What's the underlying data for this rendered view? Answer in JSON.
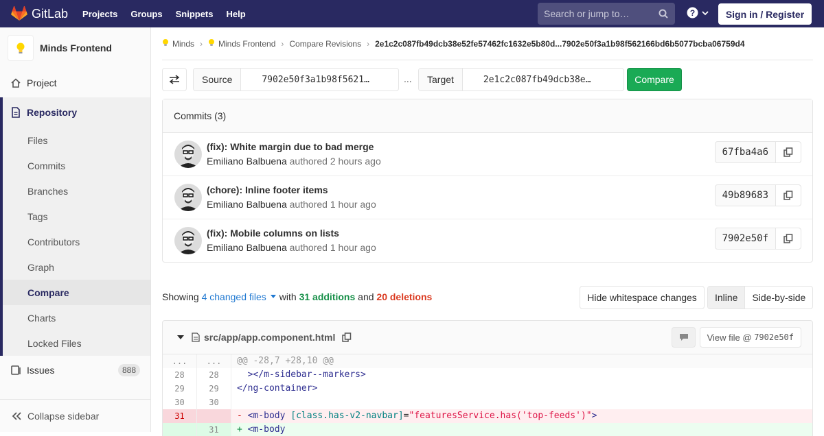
{
  "header": {
    "brand": "GitLab",
    "nav": [
      "Projects",
      "Groups",
      "Snippets",
      "Help"
    ],
    "search_placeholder": "Search or jump to…",
    "sign_in": "Sign in / Register"
  },
  "sidebar": {
    "project_name": "Minds Frontend",
    "project": "Project",
    "repository": "Repository",
    "repo_items": [
      "Files",
      "Commits",
      "Branches",
      "Tags",
      "Contributors",
      "Graph",
      "Compare",
      "Charts",
      "Locked Files"
    ],
    "issues": "Issues",
    "issues_count": "888",
    "collapse": "Collapse sidebar"
  },
  "breadcrumb": {
    "items": [
      "Minds",
      "Minds Frontend",
      "Compare Revisions"
    ],
    "current": "2e1c2c087fb49dcb38e52fe57462fc1632e5b80d...7902e50f3a1b98f562166bd6b5077bcba06759d4"
  },
  "compare": {
    "source_label": "Source",
    "source_value": "7902e50f3a1b98f5621…",
    "dots": "...",
    "target_label": "Target",
    "target_value": "2e1c2c087fb49dcb38e…",
    "compare_button": "Compare"
  },
  "commits": {
    "heading": "Commits (3)",
    "items": [
      {
        "title": "(fix): White margin due to bad merge",
        "author": "Emiliano Balbuena",
        "action": "authored",
        "time": "2 hours ago",
        "sha": "67fba4a6"
      },
      {
        "title": "(chore): Inline footer items",
        "author": "Emiliano Balbuena",
        "action": "authored",
        "time": "1 hour ago",
        "sha": "49b89683"
      },
      {
        "title": "(fix): Mobile columns on lists",
        "author": "Emiliano Balbuena",
        "action": "authored",
        "time": "1 hour ago",
        "sha": "7902e50f"
      }
    ]
  },
  "stats": {
    "showing": "Showing",
    "changed_files": "4 changed files",
    "with": "with",
    "additions": "31 additions",
    "and": "and",
    "deletions": "20 deletions",
    "hide_ws": "Hide whitespace changes",
    "inline": "Inline",
    "side_by_side": "Side-by-side"
  },
  "file": {
    "path": "src/app/app.component.html",
    "view_file": "View file @",
    "view_sha": "7902e50f"
  },
  "diff": {
    "match_old": "...",
    "match_new": "...",
    "hunk": "@@ -28,7 +28,10 @@",
    "lines": [
      {
        "old": "28",
        "new": "28",
        "code": "  ></m-sidebar--markers>"
      },
      {
        "old": "29",
        "new": "29",
        "code": "</ng-container>"
      },
      {
        "old": "30",
        "new": "30",
        "code": ""
      }
    ],
    "removed": {
      "old": "31",
      "sign": "-",
      "tag_open": "<m-body ",
      "attr": "[class.has-v2-navbar]",
      "eq": "=",
      "str": "\"featuresService.has('top-feeds')\"",
      "tag_close": ">"
    },
    "added": {
      "new": "31",
      "sign": "+",
      "tag_open": "<m-body"
    }
  }
}
